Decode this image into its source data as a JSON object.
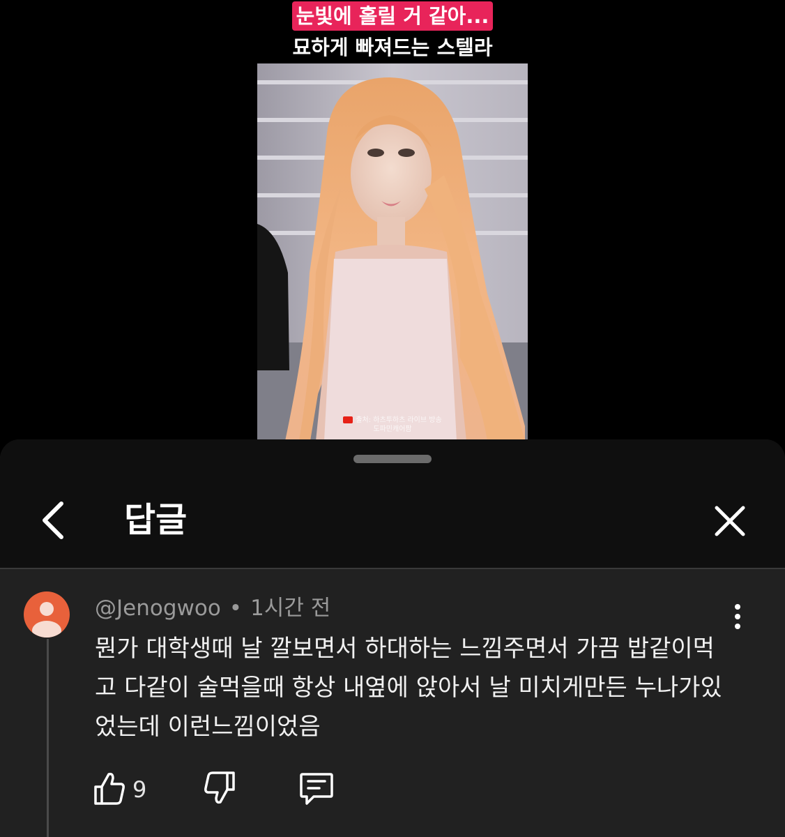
{
  "video": {
    "caption_line1": "눈빛에 홀릴 거 같아...",
    "caption_line2": "묘하게 빠져드는 스텔라",
    "credit_line1": "출처: 하츠투하츠 라이브 방송",
    "credit_line2": "도파민캐어팜"
  },
  "sheet": {
    "title": "답글"
  },
  "comment": {
    "author": "@Jenogwoo",
    "separator": "•",
    "time": "1시간 전",
    "text": "뭔가 대학생때 날 깔보면서 하대하는 느낌주면서 가끔 밥같이먹고 다같이 술먹을때 항상 내옆에 앉아서 날 미치게만든 누나가있었는데 이런느낌이었음",
    "like_count": "9"
  },
  "colors": {
    "caption_highlight": "#e8245a",
    "sheet_bg": "#212121",
    "header_bg": "#0f0f0f",
    "avatar": "#e8613b"
  },
  "icons": [
    "back-arrow-icon",
    "close-icon",
    "more-vert-icon",
    "thumbs-up-icon",
    "thumbs-down-icon",
    "reply-icon",
    "youtube-icon",
    "user-avatar-icon"
  ]
}
